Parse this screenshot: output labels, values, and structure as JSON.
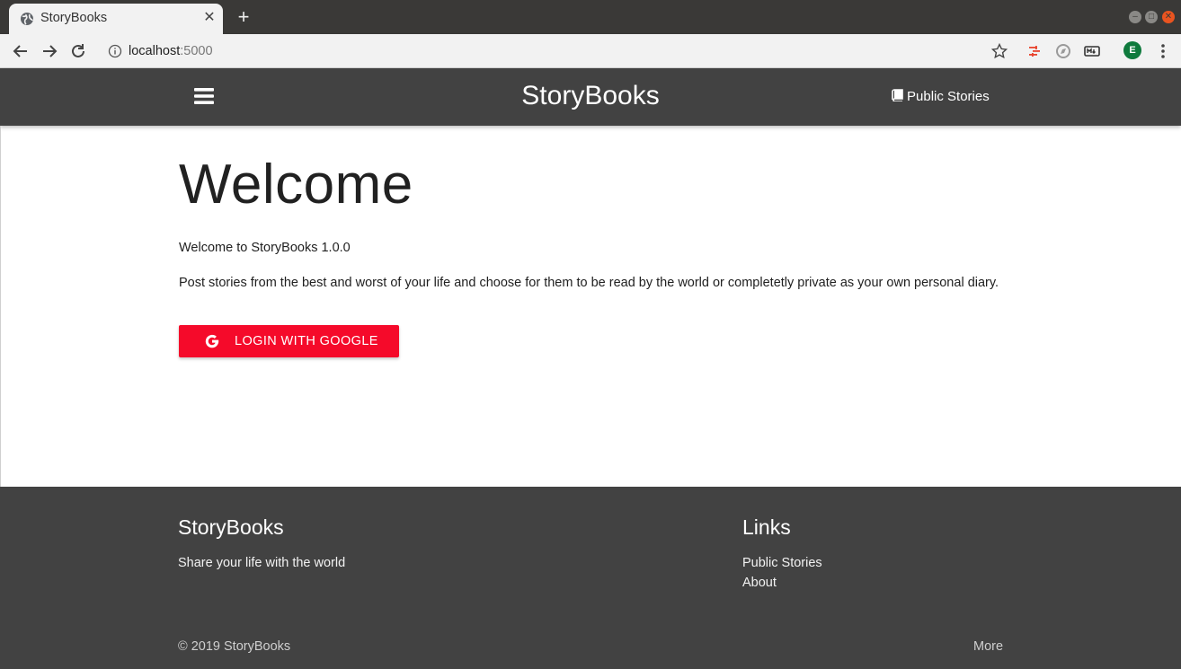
{
  "browser": {
    "tab_title": "StoryBooks",
    "url_host": "localhost",
    "url_port": ":5000",
    "profile_initial": "E"
  },
  "navbar": {
    "brand": "StoryBooks",
    "public_stories": "Public Stories"
  },
  "main": {
    "title": "Welcome",
    "version_text": "Welcome to StoryBooks 1.0.0",
    "description": "Post stories from the best and worst of your life and choose for them to be read by the world or completetly private as your own personal diary.",
    "login_button": "LOGIN WITH GOOGLE",
    "accent_color": "#f50a2a"
  },
  "footer": {
    "brand": "StoryBooks",
    "tagline": "Share your life with the world",
    "links_title": "Links",
    "links": [
      "Public Stories",
      "About"
    ],
    "copyright": "© 2019 StoryBooks",
    "more": "More",
    "background_color": "#424242"
  }
}
